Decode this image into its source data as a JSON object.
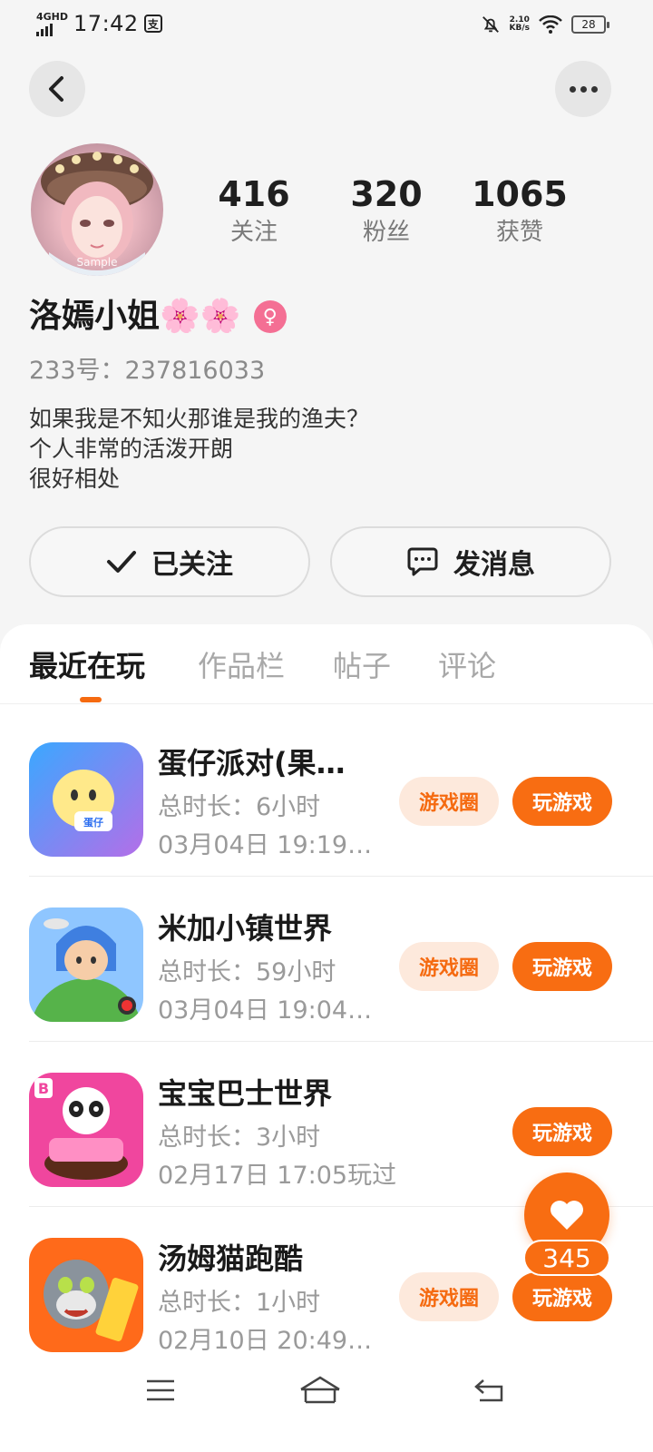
{
  "status_bar": {
    "network": "4GHD",
    "time": "17:42",
    "speed_value": "2.10",
    "speed_unit": "KB/s",
    "battery": "28"
  },
  "profile": {
    "avatar_label": "Sample",
    "username": "洛嫣小姐🌸🌸",
    "gender_symbol": "♀",
    "user_id": "233号：237816033",
    "bio": [
      "如果我是不知火那谁是我的渔夫？",
      "个人非常的活泼开朗",
      "很好相处"
    ],
    "stats": [
      {
        "value": "416",
        "label": "关注"
      },
      {
        "value": "320",
        "label": "粉丝"
      },
      {
        "value": "1065",
        "label": "获赞"
      }
    ]
  },
  "actions": {
    "follow_label": "已关注",
    "message_label": "发消息"
  },
  "tabs": [
    {
      "label": "最近在玩",
      "active": true
    },
    {
      "label": "作品栏",
      "active": false
    },
    {
      "label": "帖子",
      "active": false
    },
    {
      "label": "评论",
      "active": false
    }
  ],
  "games": [
    {
      "title": "蛋仔派对(果…",
      "duration": "总时长：6小时",
      "last_played": "03月04日 19:19…",
      "circle_label": "游戏圈",
      "play_label": "玩游戏"
    },
    {
      "title": "米加小镇世界",
      "duration": "总时长：59小时",
      "last_played": "03月04日 19:04…",
      "circle_label": "游戏圈",
      "play_label": "玩游戏"
    },
    {
      "title": "宝宝巴士世界",
      "duration": "总时长：3小时",
      "last_played": "02月17日 17:05玩过",
      "circle_label": "",
      "play_label": "玩游戏"
    },
    {
      "title": "汤姆猫跑酷",
      "duration": "总时长：1小时",
      "last_played": "02月10日 20:49…",
      "circle_label": "游戏圈",
      "play_label": "玩游戏"
    }
  ],
  "like": {
    "count": "345"
  },
  "colors": {
    "accent": "#f86d12",
    "pill_bg": "#fde9dc",
    "gender": "#f46f94"
  }
}
